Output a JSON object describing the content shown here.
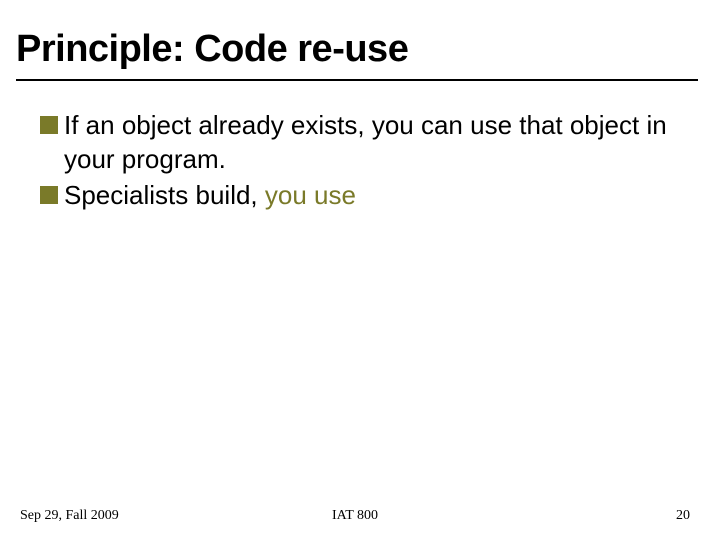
{
  "title": "Principle: Code re-use",
  "bullets": [
    {
      "prefix": "If an object already exists, you can use that object in your program.",
      "highlight": ""
    },
    {
      "prefix": "Specialists build, ",
      "highlight": "you use"
    }
  ],
  "footer": {
    "left": "Sep 29, Fall 2009",
    "center": "IAT 800",
    "right": "20"
  }
}
